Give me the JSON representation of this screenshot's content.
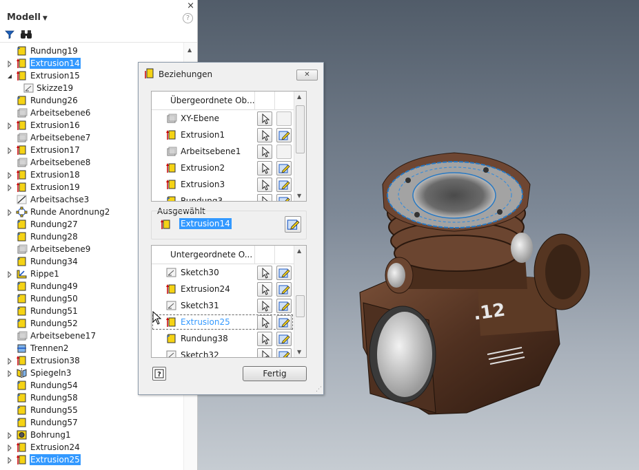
{
  "browser": {
    "title": "Modell",
    "close_glyph": "×",
    "help_glyph": "?",
    "filter_icon": "filter-icon",
    "find_icon": "binoculars-icon",
    "tree": [
      {
        "label": "Rundung19",
        "icon": "fillet",
        "expandable": false,
        "selected": false
      },
      {
        "label": "Extrusion14",
        "icon": "extrude",
        "expandable": true,
        "selected": true
      },
      {
        "label": "Extrusion15",
        "icon": "extrude",
        "expandable": true,
        "expanded": true,
        "selected": false
      },
      {
        "label": "Skizze19",
        "icon": "sketch",
        "expandable": false,
        "selected": false,
        "child": true
      },
      {
        "label": "Rundung26",
        "icon": "fillet",
        "expandable": false,
        "selected": false
      },
      {
        "label": "Arbeitsebene6",
        "icon": "plane",
        "expandable": false,
        "selected": false
      },
      {
        "label": "Extrusion16",
        "icon": "extrude",
        "expandable": true,
        "selected": false
      },
      {
        "label": "Arbeitsebene7",
        "icon": "plane",
        "expandable": false,
        "selected": false
      },
      {
        "label": "Extrusion17",
        "icon": "extrude",
        "expandable": true,
        "selected": false
      },
      {
        "label": "Arbeitsebene8",
        "icon": "plane",
        "expandable": false,
        "selected": false
      },
      {
        "label": "Extrusion18",
        "icon": "extrude",
        "expandable": true,
        "selected": false
      },
      {
        "label": "Extrusion19",
        "icon": "extrude",
        "expandable": true,
        "selected": false
      },
      {
        "label": "Arbeitsachse3",
        "icon": "axis",
        "expandable": false,
        "selected": false
      },
      {
        "label": "Runde Anordnung2",
        "icon": "pattern",
        "expandable": true,
        "selected": false
      },
      {
        "label": "Rundung27",
        "icon": "fillet",
        "expandable": false,
        "selected": false
      },
      {
        "label": "Rundung28",
        "icon": "fillet",
        "expandable": false,
        "selected": false
      },
      {
        "label": "Arbeitsebene9",
        "icon": "plane",
        "expandable": false,
        "selected": false
      },
      {
        "label": "Rundung34",
        "icon": "fillet",
        "expandable": false,
        "selected": false
      },
      {
        "label": "Rippe1",
        "icon": "rib",
        "expandable": true,
        "selected": false
      },
      {
        "label": "Rundung49",
        "icon": "fillet",
        "expandable": false,
        "selected": false
      },
      {
        "label": "Rundung50",
        "icon": "fillet",
        "expandable": false,
        "selected": false
      },
      {
        "label": "Rundung51",
        "icon": "fillet",
        "expandable": false,
        "selected": false
      },
      {
        "label": "Rundung52",
        "icon": "fillet",
        "expandable": false,
        "selected": false
      },
      {
        "label": "Arbeitsebene17",
        "icon": "plane",
        "expandable": false,
        "selected": false
      },
      {
        "label": "Trennen2",
        "icon": "split",
        "expandable": false,
        "selected": false
      },
      {
        "label": "Extrusion38",
        "icon": "extrude",
        "expandable": true,
        "selected": false
      },
      {
        "label": "Spiegeln3",
        "icon": "mirror",
        "expandable": true,
        "selected": false
      },
      {
        "label": "Rundung54",
        "icon": "fillet",
        "expandable": false,
        "selected": false
      },
      {
        "label": "Rundung58",
        "icon": "fillet",
        "expandable": false,
        "selected": false
      },
      {
        "label": "Rundung55",
        "icon": "fillet",
        "expandable": false,
        "selected": false
      },
      {
        "label": "Rundung57",
        "icon": "fillet",
        "expandable": false,
        "selected": false
      },
      {
        "label": "Bohrung1",
        "icon": "hole",
        "expandable": true,
        "selected": false
      },
      {
        "label": "Extrusion24",
        "icon": "extrude",
        "expandable": true,
        "selected": false
      },
      {
        "label": "Extrusion25",
        "icon": "extrude",
        "expandable": true,
        "selected": true
      }
    ]
  },
  "dialog": {
    "title": "Beziehungen",
    "parents_header": "Übergeordnete Ob...",
    "parents": [
      {
        "label": "XY-Ebene",
        "icon": "plane",
        "editable": false
      },
      {
        "label": "Extrusion1",
        "icon": "extrude",
        "editable": true
      },
      {
        "label": "Arbeitsebene1",
        "icon": "plane",
        "editable": false
      },
      {
        "label": "Extrusion2",
        "icon": "extrude",
        "editable": true
      },
      {
        "label": "Extrusion3",
        "icon": "extrude",
        "editable": true
      },
      {
        "label": "Rundung3",
        "icon": "fillet",
        "editable": true
      }
    ],
    "selected_label": "Ausgewählt",
    "selected_value": "Extrusion14",
    "children_header": "Untergeordnete O...",
    "children": [
      {
        "label": "Sketch30",
        "icon": "sketch",
        "editable": true,
        "highlight": false
      },
      {
        "label": "Extrusion24",
        "icon": "extrude",
        "editable": true,
        "highlight": false
      },
      {
        "label": "Sketch31",
        "icon": "sketch",
        "editable": true,
        "highlight": false
      },
      {
        "label": "Extrusion25",
        "icon": "extrude",
        "editable": true,
        "highlight": true
      },
      {
        "label": "Rundung38",
        "icon": "fillet",
        "editable": true,
        "highlight": false
      },
      {
        "label": "Sketch32",
        "icon": "sketch",
        "editable": true,
        "highlight": false
      }
    ],
    "done_label": "Fertig",
    "help_glyph": "?"
  },
  "viewport": {
    "model_label": ".12",
    "model_color": "#5a3a26"
  },
  "colors": {
    "selection": "#3399ff",
    "extrude_yellow": "#f5d315",
    "viewport_top": "#515c69",
    "viewport_bottom": "#c6ccd2"
  }
}
